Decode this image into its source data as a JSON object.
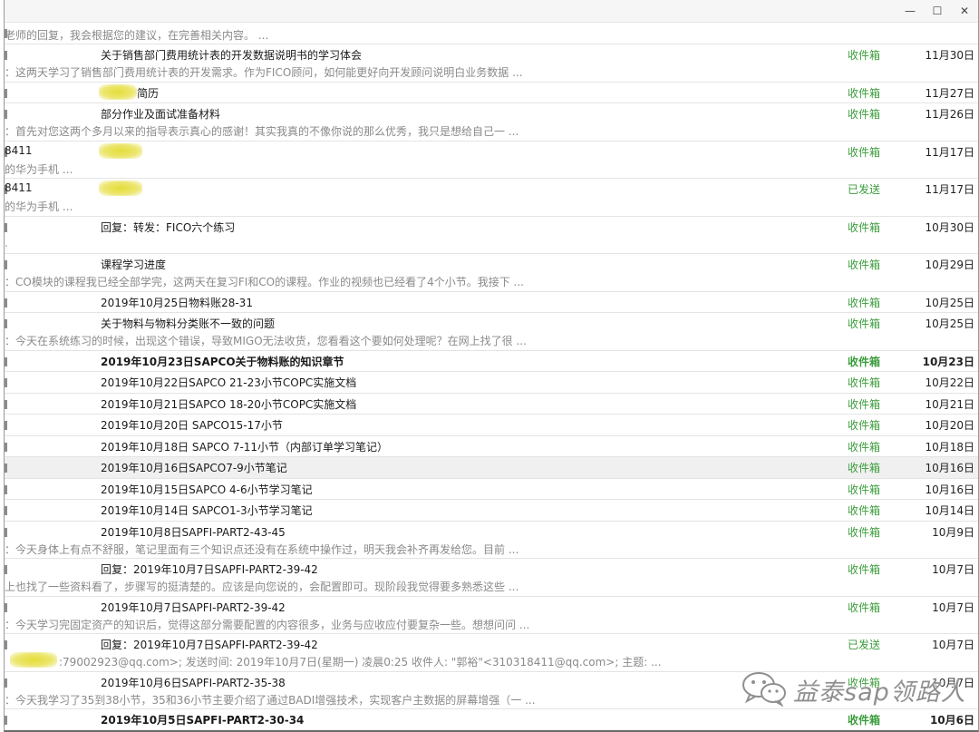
{
  "window": {
    "minimize": "—",
    "maximize": "☐",
    "close": "✕"
  },
  "rows": [
    {
      "sender": "",
      "subject": "",
      "preview": "老师的回复，我会根据您的建议，在完善相关内容。 ...",
      "folder": "",
      "date": "",
      "bold": false,
      "partial_top": true
    },
    {
      "sender": "",
      "subject": "关于销售部门费用统计表的开发数据说明书的学习体会",
      "preview": "：这两天学习了销售部门费用统计表的开发需求。作为FICO顾问，如何能更好向开发顾问说明白业务数据 ...",
      "folder": "收件箱",
      "date": "11月30日",
      "bold": false
    },
    {
      "sender": "",
      "subject": "简历",
      "preview": "",
      "folder": "收件箱",
      "date": "11月27日",
      "bold": false,
      "blur": true
    },
    {
      "sender": "",
      "subject": "部分作业及面试准备材料",
      "preview": "：首先对您这两个多月以来的指导表示真心的感谢！其实我真的不像你说的那么优秀，我只是想给自己一 ...",
      "folder": "收件箱",
      "date": "11月26日",
      "bold": false
    },
    {
      "sender": "8411",
      "subject": "",
      "preview": "的华为手机 ...",
      "folder": "收件箱",
      "date": "11月17日",
      "bold": false,
      "blur": true
    },
    {
      "sender": "8411",
      "subject": "",
      "preview": "的华为手机 ...",
      "folder": "已发送",
      "date": "11月17日",
      "bold": false,
      "blur": true
    },
    {
      "sender": "",
      "subject": "回复：转发：FICO六个练习",
      "preview": ".",
      "folder": "收件箱",
      "date": "10月30日",
      "bold": false
    },
    {
      "sender": "",
      "subject": "课程学习进度",
      "preview": "：CO模块的课程我已经全部学完，这两天在复习FI和CO的课程。作业的视频也已经看了4个小节。我接下 ...",
      "folder": "收件箱",
      "date": "10月29日",
      "bold": false
    },
    {
      "sender": "",
      "subject": "2019年10月25日物料账28-31",
      "preview": "",
      "folder": "收件箱",
      "date": "10月25日",
      "bold": false
    },
    {
      "sender": "",
      "subject": "关于物料与物料分类账不一致的问题",
      "preview": "：今天在系统练习的时候，出现这个错误，导致MIGO无法收货，您看看这个要如何处理呢？在网上找了很 ...",
      "folder": "收件箱",
      "date": "10月25日",
      "bold": false
    },
    {
      "sender": "",
      "subject": "2019年10月23日SAPCO关于物料账的知识章节",
      "preview": "",
      "folder": "收件箱",
      "date": "10月23日",
      "bold": true
    },
    {
      "sender": "",
      "subject": "2019年10月22日SAPCO 21-23小节COPC实施文档",
      "preview": "",
      "folder": "收件箱",
      "date": "10月22日",
      "bold": false
    },
    {
      "sender": "",
      "subject": "2019年10月21日SAPCO 18-20小节COPC实施文档",
      "preview": "",
      "folder": "收件箱",
      "date": "10月21日",
      "bold": false
    },
    {
      "sender": "",
      "subject": "2019年10月20日 SAPCO15-17小节",
      "preview": "",
      "folder": "收件箱",
      "date": "10月20日",
      "bold": false
    },
    {
      "sender": "",
      "subject": "2019年10月18日 SAPCO 7-11小节（内部订单学习笔记）",
      "preview": "",
      "folder": "收件箱",
      "date": "10月18日",
      "bold": false
    },
    {
      "sender": "",
      "subject": "2019年10月16日SAPCO7-9小节笔记",
      "preview": "",
      "folder": "收件箱",
      "date": "10月16日",
      "bold": false,
      "selected": true
    },
    {
      "sender": "",
      "subject": "2019年10月15日SAPCO 4-6小节学习笔记",
      "preview": "",
      "folder": "收件箱",
      "date": "10月16日",
      "bold": false
    },
    {
      "sender": "",
      "subject": "2019年10月14日 SAPCO1-3小节学习笔记",
      "preview": "",
      "folder": "收件箱",
      "date": "10月14日",
      "bold": false
    },
    {
      "sender": "",
      "subject": "2019年10月8日SAPFI-PART2-43-45",
      "preview": "：今天身体上有点不舒服，笔记里面有三个知识点还没有在系统中操作过，明天我会补齐再发给您。目前 ...",
      "folder": "收件箱",
      "date": "10月9日",
      "bold": false
    },
    {
      "sender": "",
      "subject": "回复：2019年10月7日SAPFI-PART2-39-42",
      "preview": "上也找了一些资料看了，步骤写的挺清楚的。应该是向您说的，会配置即可。现阶段我觉得要多熟悉这些 ...",
      "folder": "收件箱",
      "date": "10月7日",
      "bold": false
    },
    {
      "sender": "",
      "subject": "2019年10月7日SAPFI-PART2-39-42",
      "preview": "：今天学习完固定资产的知识后，觉得这部分需要配置的内容很多，业务与应收应付要复杂一些。想想问问 ...",
      "folder": "收件箱",
      "date": "10月7日",
      "bold": false
    },
    {
      "sender": "",
      "subject": "回复：2019年10月7日SAPFI-PART2-39-42",
      "preview": ":79002923@qq.com>; 发送时间: 2019年10月7日(星期一) 凌晨0:25 收件人: \"郭裕\"<310318411@qq.com>; 主题: ...",
      "folder": "已发送",
      "date": "10月7日",
      "bold": false,
      "blur_preview": true
    },
    {
      "sender": "",
      "subject": "2019年10月6日SAPFI-PART2-35-38",
      "preview": "：今天我学习了35到38小节，35和36小节主要介绍了通过BADI增强技术，实现客户主数据的屏幕增强（一 ...",
      "folder": "收件箱",
      "date": "10月7日",
      "bold": false
    },
    {
      "sender": "",
      "subject": "2019年10月5日SAPFI-PART2-30-34",
      "preview": "",
      "folder": "收件箱",
      "date": "10月6日",
      "bold": true
    }
  ],
  "watermark": {
    "text": "益泰sap领路人",
    "icon": "wechat-icon"
  },
  "colors": {
    "folder": "#3b9c3b",
    "preview": "#8a8a8a",
    "selected_row": "#f0f0f0"
  }
}
